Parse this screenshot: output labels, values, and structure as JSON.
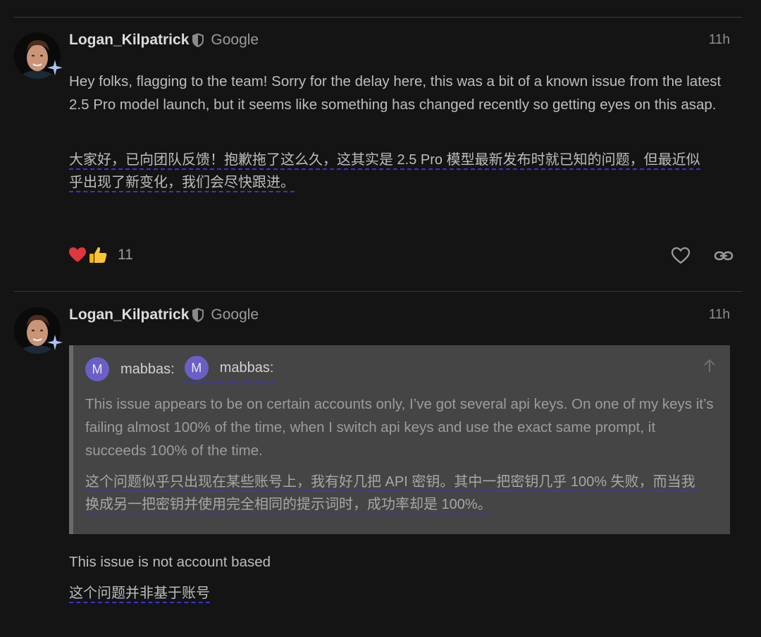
{
  "posts": [
    {
      "username": "Logan_Kilpatrick",
      "org": "Google",
      "time": "11h",
      "body": "Hey folks, flagging to the team! Sorry for the delay here, this was a bit of a known issue from the latest 2.5 Pro model launch, but it seems like something has changed recently so getting eyes on this asap.",
      "translation_lines": [
        "大家好，已向团队反馈！抱歉拖了这么久，这其实是 2.5 Pro 模型最新发布时就已知的问题，但最近似",
        "乎出现了新变化，我们会尽快跟进。"
      ],
      "reactions": {
        "icons": [
          "heart-reaction-icon",
          "thumbs-up-reaction-icon"
        ],
        "count": "11"
      }
    },
    {
      "username": "Logan_Kilpatrick",
      "org": "Google",
      "time": "11h",
      "quote": {
        "avatar_letter": "M",
        "author": "mabbas:",
        "author_repeat": "mabbas:",
        "text": "This issue appears to be on certain accounts only, I’ve got several api keys. On one of my keys it’s failing almost 100% of the time, when I switch api keys and use the exact same prompt, it succeeds 100% of the time.",
        "translation_lines": [
          "这个问题似乎只出现在某些账号上，我有好几把 API 密钥。其中一把密钥几乎 100% 失败，而当我",
          "换成另一把密钥并使用完全相同的提示词时，成功率却是 100%。"
        ]
      },
      "body": "This issue is not account based",
      "translation": "这个问题并非基于账号"
    }
  ],
  "colors": {
    "background": "#141414",
    "quote_background": "#454545",
    "translation_underline": "#3a33d6",
    "avatar_m": "#6a5fc6"
  }
}
